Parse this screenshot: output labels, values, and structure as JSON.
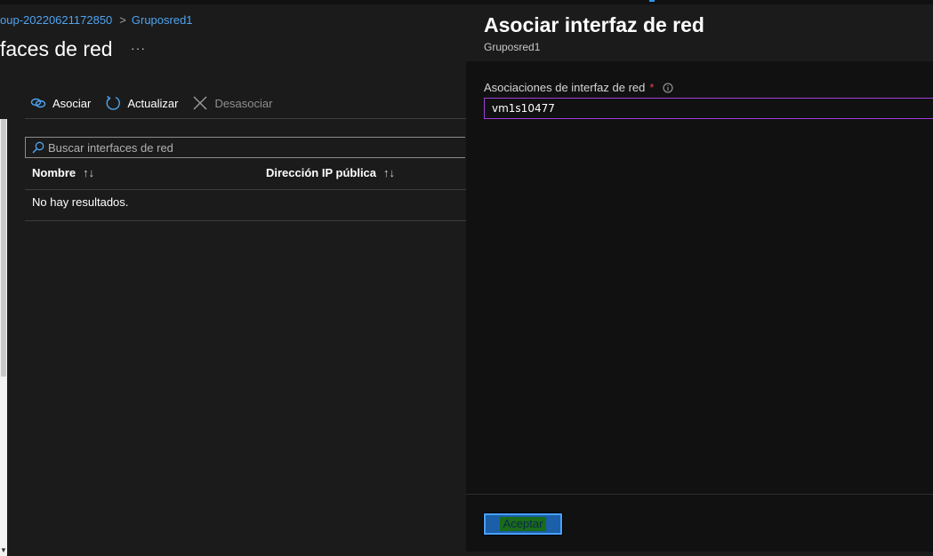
{
  "breadcrumb": {
    "parent": "oup-20220621172850",
    "separator": ">",
    "current": "Gruposred1"
  },
  "page": {
    "title": "faces de red",
    "more_label": "···"
  },
  "toolbar": {
    "associate_label": "Asociar",
    "refresh_label": "Actualizar",
    "dissociate_label": "Desasociar"
  },
  "search": {
    "placeholder": "Buscar interfaces de red",
    "value": ""
  },
  "table": {
    "columns": [
      {
        "label": "Nombre",
        "sort_glyph": "↑↓"
      },
      {
        "label": "Dirección IP pública",
        "sort_glyph": "↑↓"
      }
    ],
    "empty_text": "No hay resultados."
  },
  "panel": {
    "title": "Asociar interfaz de red",
    "subtitle": "Gruposred1",
    "field_label": "Asociaciones de interfaz de red",
    "required_mark": "*",
    "field_value": "vm1s10477",
    "accept_label": "Aceptar"
  },
  "icons": {
    "associate": "link-icon",
    "refresh": "refresh-icon",
    "dissociate": "close-icon",
    "search": "search-icon",
    "info": "info-icon"
  },
  "colors": {
    "link": "#4fa3f0",
    "background": "#1b1b1b",
    "panel_background": "#111111",
    "field_border": "#9b3fd6",
    "required": "#e0414b",
    "accent": "#2899f5"
  }
}
